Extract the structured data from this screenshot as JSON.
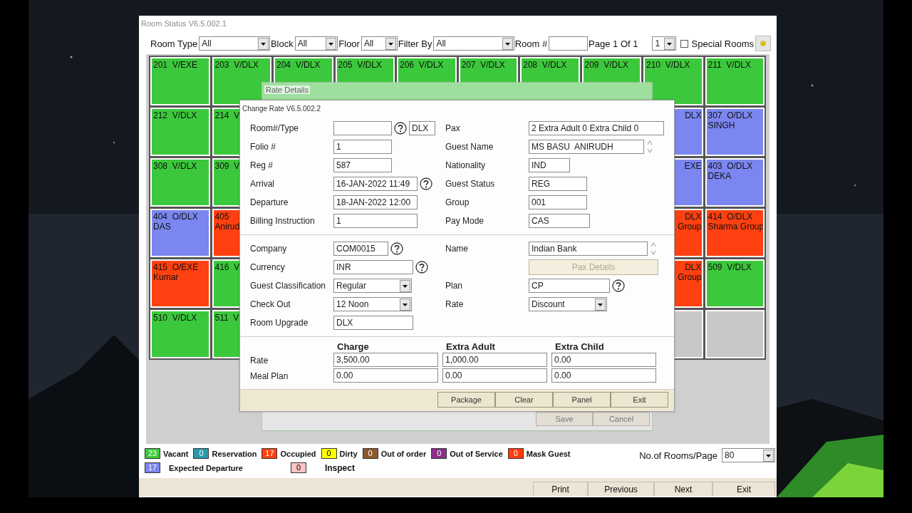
{
  "window": {
    "title": "Room Status V6.5.002.1"
  },
  "toolbar": {
    "filters": [
      {
        "label": "Room Type",
        "kind": "select",
        "value": "All"
      },
      {
        "label": "Block",
        "kind": "select",
        "value": "All"
      },
      {
        "label": "Floor",
        "kind": "select",
        "value": "All"
      },
      {
        "label": "Filter By",
        "kind": "select",
        "value": "All"
      },
      {
        "label": "Room #",
        "kind": "text"
      }
    ],
    "page_label": "Page 1 Of 1",
    "page_select": "1",
    "special_rooms": {
      "label": "Special Rooms",
      "checked": false
    }
  },
  "room_grid": {
    "rows": [
      [
        {
          "number": "201",
          "type": "V/EXE",
          "color": "#3cc83c"
        },
        {
          "number": "203",
          "type": "V/DLX",
          "color": "#3cc83c"
        },
        {
          "number": "204",
          "type": "V/DLX",
          "color": "#3cc83c"
        },
        {
          "number": "205",
          "type": "V/DLX",
          "color": "#3cc83c"
        },
        {
          "number": "206",
          "type": "V/DLX",
          "color": "#3cc83c"
        },
        {
          "number": "207",
          "type": "V/DLX",
          "color": "#3cc83c"
        },
        {
          "number": "208",
          "type": "V/DLX",
          "color": "#3cc83c"
        },
        {
          "number": "209",
          "type": "V/DLX",
          "color": "#3cc83c"
        },
        {
          "number": "210",
          "type": "V/DLX",
          "color": "#3cc83c"
        },
        {
          "number": "211",
          "type": "V/DLX",
          "color": "#3cc83c"
        }
      ],
      [
        {
          "number": "212",
          "type": "V/DLX",
          "color": "#3cc83c"
        },
        {
          "number": "214",
          "type": "V",
          "color": "#3cc83c"
        },
        null,
        null,
        null,
        null,
        null,
        null,
        {
          "type": "DLX",
          "color": "#7b86f0"
        },
        {
          "number": "307",
          "type": "O/DLX",
          "guest": "SINGH",
          "color": "#7b86f0"
        }
      ],
      [
        {
          "number": "308",
          "type": "V/DLX",
          "color": "#3cc83c"
        },
        {
          "number": "309",
          "type": "V",
          "color": "#3cc83c"
        },
        null,
        null,
        null,
        null,
        null,
        null,
        {
          "type": "EXE",
          "color": "#7b86f0"
        },
        {
          "number": "403",
          "type": "O/DLX",
          "guest": "DEKA",
          "color": "#7b86f0"
        }
      ],
      [
        {
          "number": "404",
          "type": "O/DLX",
          "guest": "DAS",
          "color": "#7b86f0"
        },
        {
          "number": "405",
          "guest": "Anirud",
          "color": "#ff4010"
        },
        null,
        null,
        null,
        null,
        null,
        null,
        {
          "type": "DLX",
          "guest": "Group",
          "color": "#ff4010"
        },
        {
          "number": "414",
          "type": "O/DLX",
          "guest": "Sharma Group",
          "color": "#ff4010"
        }
      ],
      [
        {
          "number": "415",
          "type": "O/EXE",
          "guest": "Kumar",
          "color": "#ff4010"
        },
        {
          "number": "416",
          "type": "V",
          "color": "#3cc83c"
        },
        null,
        null,
        null,
        null,
        null,
        null,
        {
          "type": "DLX",
          "guest": "Group",
          "color": "#ff4010"
        },
        {
          "number": "509",
          "type": "V/DLX",
          "color": "#3cc83c"
        }
      ],
      [
        {
          "number": "510",
          "type": "V/DLX",
          "color": "#3cc83c"
        },
        {
          "number": "511",
          "type": "V",
          "color": "#3cc83c"
        },
        null,
        null,
        null,
        null,
        null,
        null,
        {
          "color": "#c8c8c8"
        },
        {
          "color": "#c8c8c8"
        }
      ]
    ]
  },
  "rate_details_dialog": {
    "title": "Rate Details",
    "buttons": [
      "Save",
      "Cancel"
    ]
  },
  "change_rate_dialog": {
    "title": "Change Rate V6.5.002.2",
    "sections": [
      {
        "rows": [
          {
            "left": {
              "label": "Room#/Type",
              "controls": [
                {
                  "kind": "text"
                },
                {
                  "kind": "help"
                },
                {
                  "kind": "text",
                  "value": "DLX"
                }
              ]
            },
            "right": {
              "label": "Pax",
              "controls": [
                {
                  "kind": "text",
                  "value": "2 Extra Adult 0 Extra Child 0"
                }
              ]
            }
          },
          {
            "left": {
              "label": "Folio #",
              "controls": [
                {
                  "kind": "text",
                  "value": "1"
                }
              ]
            },
            "right": {
              "label": "Guest Name",
              "controls": [
                {
                  "kind": "text",
                  "value": "MS BASU  ANIRUDH"
                },
                {
                  "kind": "spin"
                }
              ]
            }
          },
          {
            "left": {
              "label": "Reg #",
              "controls": [
                {
                  "kind": "text",
                  "value": "587"
                }
              ]
            },
            "right": {
              "label": "Nationality",
              "controls": [
                {
                  "kind": "text",
                  "value": "IND"
                }
              ]
            }
          },
          {
            "left": {
              "label": "Arrival",
              "controls": [
                {
                  "kind": "text",
                  "value": "16-JAN-2022 11:49"
                },
                {
                  "kind": "help"
                }
              ]
            },
            "right": {
              "label": "Guest Status",
              "controls": [
                {
                  "kind": "text",
                  "value": "REG"
                }
              ]
            }
          },
          {
            "left": {
              "label": "Departure",
              "controls": [
                {
                  "kind": "text",
                  "value": "18-JAN-2022 12:00"
                }
              ]
            },
            "right": {
              "label": "Group",
              "controls": [
                {
                  "kind": "text",
                  "value": "001"
                }
              ]
            }
          },
          {
            "left": {
              "label": "Billing Instruction",
              "controls": [
                {
                  "kind": "text",
                  "value": "1"
                }
              ]
            },
            "right": {
              "label": "Pay Mode",
              "controls": [
                {
                  "kind": "text",
                  "value": "CAS"
                }
              ]
            }
          }
        ]
      },
      {
        "rows": [
          {
            "left": {
              "label": "Company",
              "controls": [
                {
                  "kind": "text",
                  "value": "COM0015"
                },
                {
                  "kind": "help"
                }
              ]
            },
            "right": {
              "label": "Name",
              "controls": [
                {
                  "kind": "text",
                  "value": "Indian Bank"
                },
                {
                  "kind": "spin"
                }
              ]
            }
          },
          {
            "left": {
              "label": "Currency",
              "controls": [
                {
                  "kind": "text",
                  "value": "INR"
                },
                {
                  "kind": "help"
                }
              ]
            },
            "right": {
              "controls": [
                {
                  "kind": "button",
                  "value": "Pax Details",
                  "disabled": true
                }
              ]
            }
          },
          {
            "left": {
              "label": "Guest Classification",
              "controls": [
                {
                  "kind": "select",
                  "value": "Regular"
                }
              ]
            },
            "right": {
              "label": "Plan",
              "controls": [
                {
                  "kind": "text",
                  "value": "CP"
                },
                {
                  "kind": "help"
                }
              ]
            }
          },
          {
            "left": {
              "label": "Check Out",
              "controls": [
                {
                  "kind": "select",
                  "value": "12 Noon"
                }
              ]
            },
            "right": {
              "label": "Rate",
              "controls": [
                {
                  "kind": "select",
                  "value": "Discount"
                }
              ]
            }
          },
          {
            "left": {
              "label": "Room Upgrade",
              "controls": [
                {
                  "kind": "text",
                  "value": "DLX"
                }
              ]
            }
          }
        ]
      }
    ],
    "rate_table": {
      "columns": [
        "Charge",
        "Extra Adult",
        "Extra Child"
      ],
      "rows": [
        {
          "label": "Rate",
          "values": [
            "3,500.00",
            "1,000.00",
            "0.00"
          ]
        },
        {
          "label": "Meal Plan",
          "values": [
            "0.00",
            "0.00",
            "0.00"
          ]
        }
      ]
    },
    "buttons": [
      "Package",
      "Clear",
      "Panel",
      "Exit"
    ]
  },
  "legend": [
    {
      "count": "23",
      "label": "Vacant",
      "color": "#3cc83c"
    },
    {
      "count": "0",
      "label": "Reservation",
      "color": "#2a9aab"
    },
    {
      "count": "17",
      "label": "Occupied",
      "color": "#ff4010"
    },
    {
      "count": "0",
      "label": "Dirty",
      "color": "#ffff00"
    },
    {
      "count": "0",
      "label": "Out of order",
      "color": "#8b5a2b"
    },
    {
      "count": "0",
      "label": "Out of Service",
      "color": "#8b2f8b"
    },
    {
      "count": "0",
      "label": "Mask Guest",
      "color": "#ff3c0a"
    },
    {
      "count": "17",
      "label": "Expected Departure",
      "color": "#7b86f0"
    },
    {
      "count": "0",
      "label": "Inspect",
      "color": "#ffc4c4"
    }
  ],
  "rooms_per_page": {
    "label": "No.of Rooms/Page",
    "value": "80"
  },
  "footer_buttons": [
    "Print",
    "Previous",
    "Next",
    "Exit"
  ]
}
